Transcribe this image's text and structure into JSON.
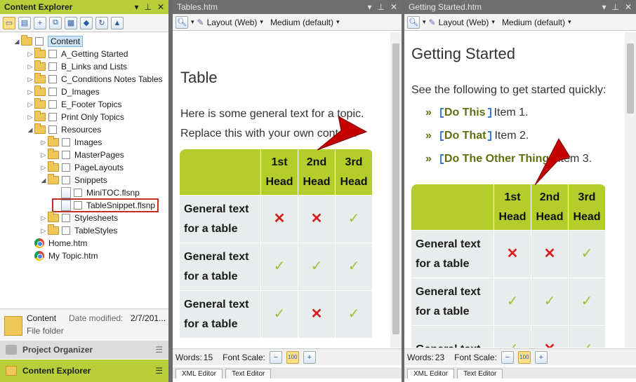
{
  "content_explorer": {
    "title": "Content Explorer",
    "tree": [
      {
        "label": "Content",
        "level": 0,
        "expanded": true,
        "selected": true
      },
      {
        "label": "A_Getting Started",
        "level": 1
      },
      {
        "label": "B_Links and Lists",
        "level": 1
      },
      {
        "label": "C_Conditions Notes Tables",
        "level": 1
      },
      {
        "label": "D_Images",
        "level": 1
      },
      {
        "label": "E_Footer Topics",
        "level": 1
      },
      {
        "label": "Print Only Topics",
        "level": 1
      },
      {
        "label": "Resources",
        "level": 1,
        "expanded": true
      },
      {
        "label": "Images",
        "level": 2
      },
      {
        "label": "MasterPages",
        "level": 2
      },
      {
        "label": "PageLayouts",
        "level": 2
      },
      {
        "label": "Snippets",
        "level": 2,
        "expanded": true
      },
      {
        "label": "MiniTOC.flsnp",
        "level": 3,
        "file": true
      },
      {
        "label": "TableSnippet.flsnp",
        "level": 3,
        "file": true,
        "highlighted": true
      },
      {
        "label": "Stylesheets",
        "level": 2
      },
      {
        "label": "TableStyles",
        "level": 2
      },
      {
        "label": "Home.htm",
        "level": 1,
        "chrome": true
      },
      {
        "label": "My Topic.htm",
        "level": 1,
        "chrome": true
      }
    ],
    "details": {
      "name": "Content",
      "type": "File folder",
      "date_label": "Date modified:",
      "date_value": "2/7/201..."
    },
    "project_organizer": "Project Organizer",
    "bottom_tab": "Content Explorer"
  },
  "editor_left": {
    "title": "Tables.htm",
    "layout": "Layout (Web)",
    "medium": "Medium (default)",
    "heading": "Table",
    "para1": "Here is some general text for a topic.",
    "para2": "Replace this with your own content.",
    "table": {
      "headers": [
        [
          "1st",
          "Head"
        ],
        [
          "2nd",
          "Head"
        ],
        [
          "3rd",
          "Head"
        ]
      ],
      "rows": [
        {
          "label": [
            "General text",
            "for a table"
          ],
          "cells": [
            "x",
            "x",
            "check"
          ]
        },
        {
          "label": [
            "General text",
            "for a table"
          ],
          "cells": [
            "check",
            "check",
            "check"
          ]
        },
        {
          "label": [
            "General text",
            "for a table"
          ],
          "cells": [
            "check",
            "x",
            "check"
          ]
        }
      ]
    },
    "words_label": "Words:",
    "words": "15",
    "font_scale": "Font Scale:",
    "tabs": [
      "XML Editor",
      "Text Editor"
    ]
  },
  "editor_right": {
    "title": "Getting Started.htm",
    "layout": "Layout (Web)",
    "medium": "Medium (default)",
    "heading": "Getting Started",
    "intro": "See the following to get started quickly:",
    "bullets": [
      {
        "link": "Do This",
        "text": "Item 1."
      },
      {
        "link": "Do That",
        "text": "Item 2."
      },
      {
        "link": "Do The Other Thing",
        "text": "Item 3."
      }
    ],
    "table": {
      "headers": [
        [
          "1st",
          "Head"
        ],
        [
          "2nd",
          "Head"
        ],
        [
          "3rd",
          "Head"
        ]
      ],
      "rows": [
        {
          "label": [
            "General text",
            "for a table"
          ],
          "cells": [
            "x",
            "x",
            "check"
          ]
        },
        {
          "label": [
            "General text",
            "for a table"
          ],
          "cells": [
            "check",
            "check",
            "check"
          ]
        },
        {
          "label": [
            "General text",
            ""
          ],
          "cells": [
            "check",
            "x",
            "check"
          ]
        }
      ]
    },
    "words_label": "Words:",
    "words": "23",
    "font_scale": "Font Scale:",
    "tabs": [
      "XML Editor",
      "Text Editor"
    ]
  },
  "colors": {
    "accent_green": "#b9cf3a",
    "table_head": "#b5cd2a",
    "x_red": "#d81b1b",
    "check_green": "#9cc03a"
  }
}
